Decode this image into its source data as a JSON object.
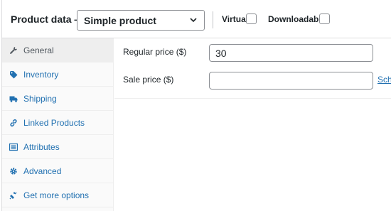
{
  "header": {
    "title": "Product data —",
    "product_type": "Simple product",
    "virtual_label": "Virtual:",
    "downloadable_label": "Downloadable:"
  },
  "tabs": [
    {
      "label": "General",
      "icon": "wrench-icon",
      "active": true
    },
    {
      "label": "Inventory",
      "icon": "tag-icon",
      "active": false
    },
    {
      "label": "Shipping",
      "icon": "truck-icon",
      "active": false
    },
    {
      "label": "Linked Products",
      "icon": "link-icon",
      "active": false
    },
    {
      "label": "Attributes",
      "icon": "list-icon",
      "active": false
    },
    {
      "label": "Advanced",
      "icon": "gear-icon",
      "active": false
    },
    {
      "label": "Get more options",
      "icon": "plugin-icon",
      "active": false
    }
  ],
  "general": {
    "regular_price_label": "Regular price ($)",
    "regular_price_value": "30",
    "sale_price_label": "Sale price ($)",
    "sale_price_value": "",
    "schedule_link": "Schedule"
  },
  "colors": {
    "link": "#2271b1",
    "border": "#8c8f94",
    "active_tab_bg": "#eeeeee"
  }
}
